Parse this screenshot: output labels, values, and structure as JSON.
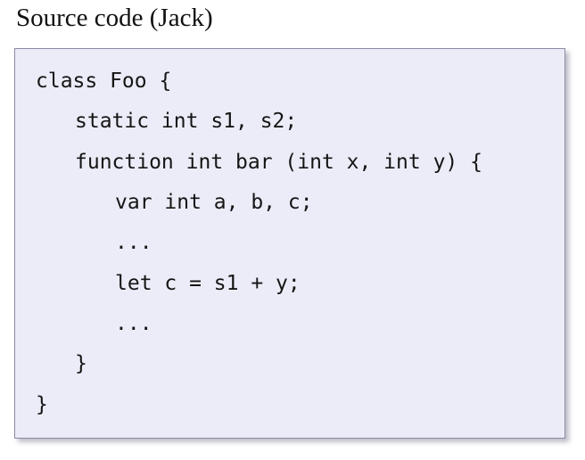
{
  "heading": "Source code (Jack)",
  "code": {
    "lines": [
      "class Foo {",
      "static int s1, s2;",
      "function int bar (int x, int y) {",
      "var int a, b, c;",
      "...",
      "let c = s1 + y;",
      "...",
      "}",
      "}"
    ]
  }
}
